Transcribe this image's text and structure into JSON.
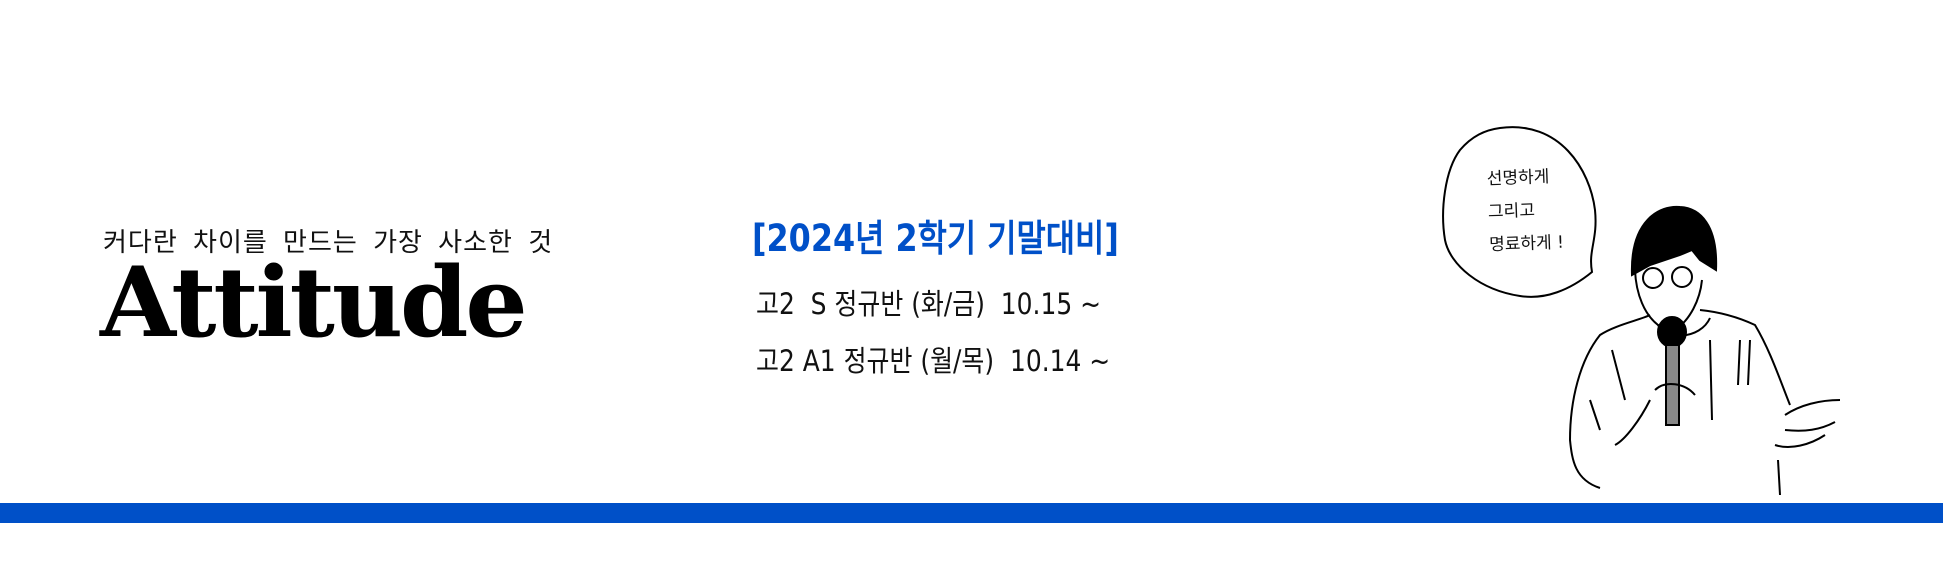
{
  "left": {
    "subtitle": "커다란 차이를 만드는 가장 사소한 것",
    "title": "Attitude"
  },
  "schedule": {
    "heading": "[2024년  2학기 기말대비]",
    "classes": [
      {
        "text": "고2  S 정규반 (화/금)  10.15 ~"
      },
      {
        "text": "고2 A1 정규반 (월/목)  10.14 ~"
      }
    ]
  },
  "illustration": {
    "speech_lines": [
      "선명하게",
      "그리고",
      "명료하게 !"
    ]
  },
  "colors": {
    "accent": "#0050c8",
    "text": "#111111"
  }
}
